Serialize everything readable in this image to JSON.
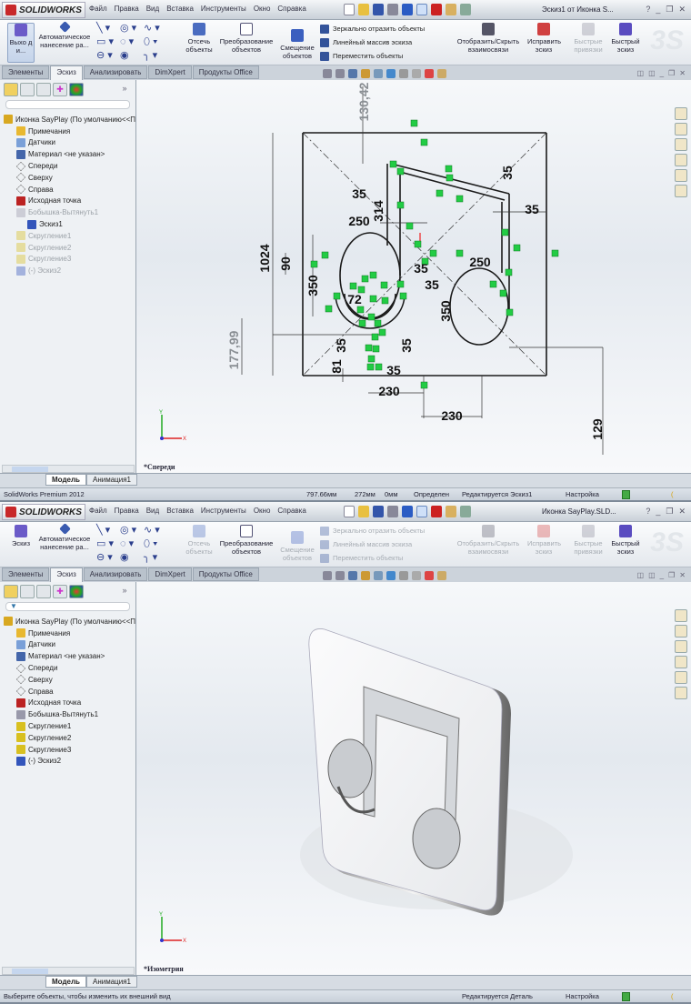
{
  "colors": {
    "accent": "#c8282a",
    "relation_green": "#22cc44",
    "sketch_line": "#1a1a1a"
  },
  "windows": [
    {
      "logo": "SOLIDWORKS",
      "menu": [
        "Файл",
        "Правка",
        "Вид",
        "Вставка",
        "Инструменты",
        "Окно",
        "Справка"
      ],
      "doc_title": "Эскиз1 от Иконка S...",
      "ribbon": {
        "first": "Выхо д и...",
        "auto_dim": "Автоматическое нанесение ра...",
        "trim": "Отсечь объекты",
        "convert": "Преобразование объектов",
        "offset": "Смещение объектов",
        "mirror": "Зеркально отразить объекты",
        "pattern": "Линейный массив эскиза",
        "move": "Переместить объекты",
        "relations": "Отобразить/Скрыть взаимосвязи",
        "repair": "Исправить эскиз",
        "snaps": "Быстрые привязки",
        "rapid": "Быстрый эскиз"
      },
      "tabs": [
        "Элементы",
        "Эскиз",
        "Анализировать",
        "DimXpert",
        "Продукты Office"
      ],
      "active_tab": 1,
      "tree": [
        {
          "label": "Иконка SayPlay  (По умолчанию<<П",
          "level": 0,
          "icon": "part-icon",
          "gray": false
        },
        {
          "label": "Примечания",
          "level": 1,
          "icon": "annotations-icon",
          "gray": false
        },
        {
          "label": "Датчики",
          "level": 1,
          "icon": "sensors-icon",
          "gray": false
        },
        {
          "label": "Материал <не указан>",
          "level": 1,
          "icon": "material-icon",
          "gray": false
        },
        {
          "label": "Спереди",
          "level": 1,
          "icon": "plane-icon",
          "gray": false
        },
        {
          "label": "Сверху",
          "level": 1,
          "icon": "plane-icon",
          "gray": false
        },
        {
          "label": "Справа",
          "level": 1,
          "icon": "plane-icon",
          "gray": false
        },
        {
          "label": "Исходная точка",
          "level": 1,
          "icon": "origin-icon",
          "gray": false
        },
        {
          "label": "Бобышка-Вытянуть1",
          "level": 1,
          "icon": "extrude-icon",
          "gray": true
        },
        {
          "label": "Эскиз1",
          "level": 2,
          "icon": "sketch-icon",
          "gray": false
        },
        {
          "label": "Скругление1",
          "level": 1,
          "icon": "fillet-icon",
          "gray": true
        },
        {
          "label": "Скругление2",
          "level": 1,
          "icon": "fillet-icon",
          "gray": true
        },
        {
          "label": "Скругление3",
          "level": 1,
          "icon": "fillet-icon",
          "gray": true
        },
        {
          "label": "(-) Эскиз2",
          "level": 1,
          "icon": "sketch-icon",
          "gray": true
        }
      ],
      "view_name": "*Спереди",
      "bottom_tabs": [
        "Модель",
        "Анимация1"
      ],
      "status": {
        "left": "SolidWorks Premium 2012",
        "x": "797.66мм",
        "y": "272мм",
        "z": "0мм",
        "state": "Определен",
        "editing": "Редактируется Эскиз1",
        "settings": "Настройка"
      },
      "dimensions": {
        "d130": "130,42",
        "d1024": "1024",
        "d90": "90",
        "d350a": "350",
        "d35a": "35",
        "d314": "314",
        "d250a": "250",
        "d35b": "35",
        "d35c": "35",
        "d250b": "250",
        "d35d": "35",
        "d35e": "35",
        "d350b": "350",
        "d72": "72",
        "d35f": "35",
        "d35g": "35",
        "d177": "177,99",
        "d81": "81",
        "d35h": "35",
        "d230a": "230",
        "d230b": "230",
        "d129": "129"
      }
    },
    {
      "logo": "SOLIDWORKS",
      "menu": [
        "Файл",
        "Правка",
        "Вид",
        "Вставка",
        "Инструменты",
        "Окно",
        "Справка"
      ],
      "doc_title": "Иконка SayPlay.SLD...",
      "ribbon": {
        "first": "Эскиз",
        "auto_dim": "Автоматическое нанесение ра...",
        "trim": "Отсечь объекты",
        "convert": "Преобразование объектов",
        "offset": "Смещение объектов",
        "mirror": "Зеркально отразить объекты",
        "pattern": "Линейный массив эскиза",
        "move": "Переместить объекты",
        "relations": "Отобразить/Скрыть взаимосвязи",
        "repair": "Исправить эскиз",
        "snaps": "Быстрые привязки",
        "rapid": "Быстрый эскиз"
      },
      "tabs": [
        "Элементы",
        "Эскиз",
        "Анализировать",
        "DimXpert",
        "Продукты Office"
      ],
      "active_tab": 1,
      "tree": [
        {
          "label": "Иконка SayPlay  (По умолчанию<<П",
          "level": 0,
          "icon": "part-icon",
          "gray": false
        },
        {
          "label": "Примечания",
          "level": 1,
          "icon": "annotations-icon",
          "gray": false
        },
        {
          "label": "Датчики",
          "level": 1,
          "icon": "sensors-icon",
          "gray": false
        },
        {
          "label": "Материал <не указан>",
          "level": 1,
          "icon": "material-icon",
          "gray": false
        },
        {
          "label": "Спереди",
          "level": 1,
          "icon": "plane-icon",
          "gray": false
        },
        {
          "label": "Сверху",
          "level": 1,
          "icon": "plane-icon",
          "gray": false
        },
        {
          "label": "Справа",
          "level": 1,
          "icon": "plane-icon",
          "gray": false
        },
        {
          "label": "Исходная точка",
          "level": 1,
          "icon": "origin-icon",
          "gray": false
        },
        {
          "label": "Бобышка-Вытянуть1",
          "level": 1,
          "icon": "extrude-icon",
          "gray": false
        },
        {
          "label": "Скругление1",
          "level": 1,
          "icon": "fillet-icon",
          "gray": false
        },
        {
          "label": "Скругление2",
          "level": 1,
          "icon": "fillet-icon",
          "gray": false
        },
        {
          "label": "Скругление3",
          "level": 1,
          "icon": "fillet-icon",
          "gray": false
        },
        {
          "label": "(-) Эскиз2",
          "level": 1,
          "icon": "sketch-icon",
          "gray": false
        }
      ],
      "view_name": "*Изометрия",
      "bottom_tabs": [
        "Модель",
        "Анимация1"
      ],
      "status": {
        "left": "Выберите объекты, чтобы изменить их внешний вид",
        "editing": "Редактируется Деталь",
        "settings": "Настройка"
      }
    }
  ]
}
